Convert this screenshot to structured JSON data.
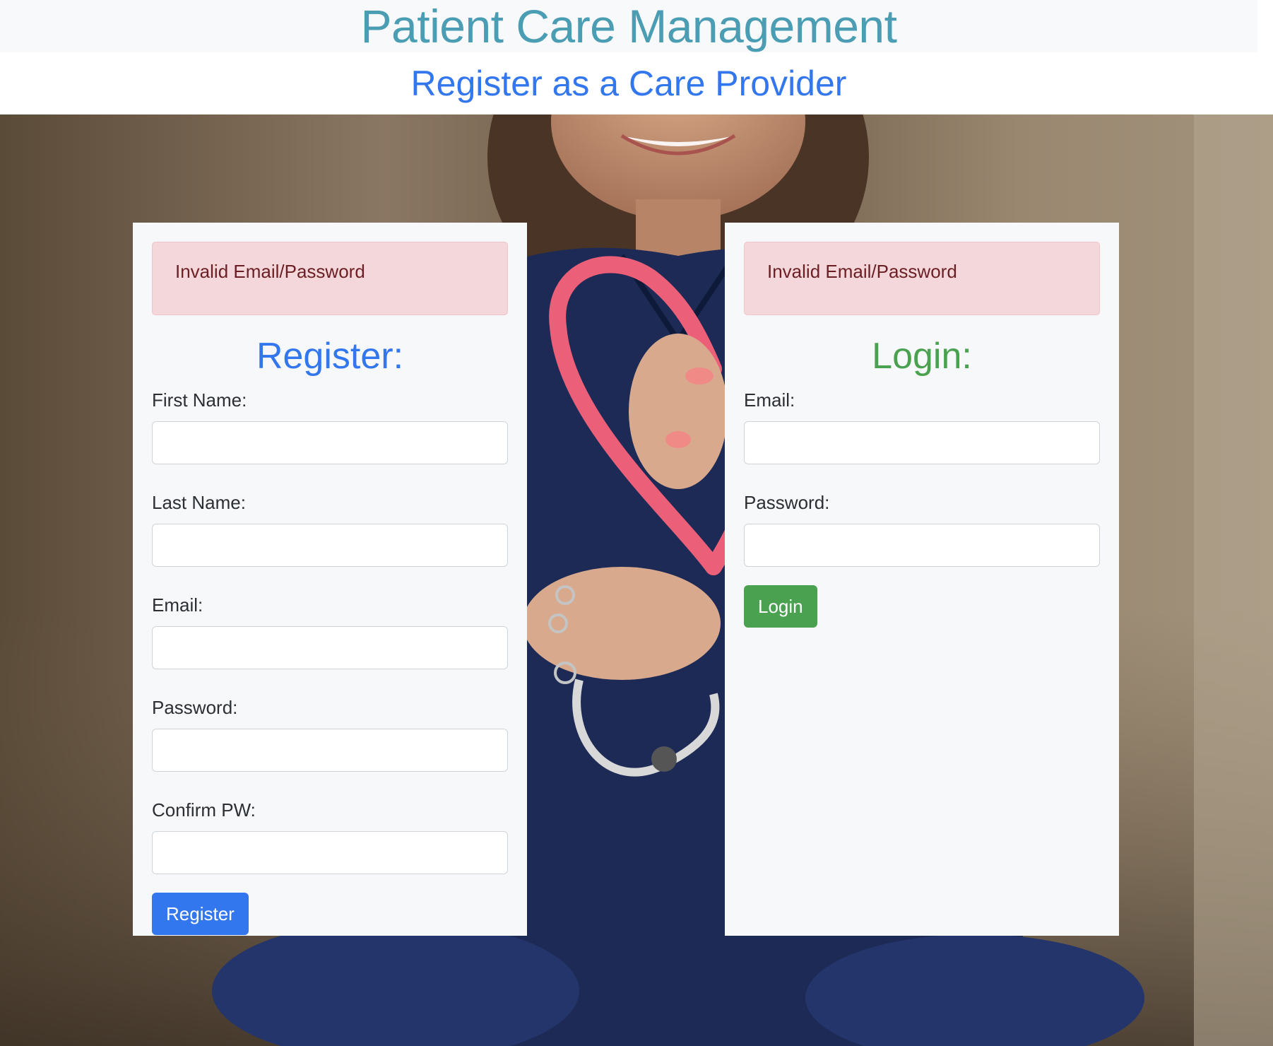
{
  "header": {
    "title": "Patient Care Management",
    "subtitle": "Register as a Care Provider"
  },
  "register": {
    "alert": "Invalid Email/Password",
    "heading": "Register:",
    "first_name_label": "First Name:",
    "last_name_label": "Last Name:",
    "email_label": "Email:",
    "password_label": "Password:",
    "confirm_label": "Confirm PW:",
    "button_label": "Register",
    "first_name_value": "",
    "last_name_value": "",
    "email_value": "",
    "password_value": "",
    "confirm_value": ""
  },
  "login": {
    "alert": "Invalid Email/Password",
    "heading": "Login:",
    "email_label": "Email:",
    "password_label": "Password:",
    "button_label": "Login",
    "email_value": "",
    "password_value": ""
  },
  "colors": {
    "title": "#4a9db3",
    "subtitle": "#3377ee",
    "register_accent": "#3377ee",
    "login_accent": "#4aa14f",
    "alert_bg": "#f4d7da",
    "alert_text": "#6b1f24"
  },
  "background": {
    "subject": "nurse-holding-heart-shaped-stethoscope-photo"
  }
}
